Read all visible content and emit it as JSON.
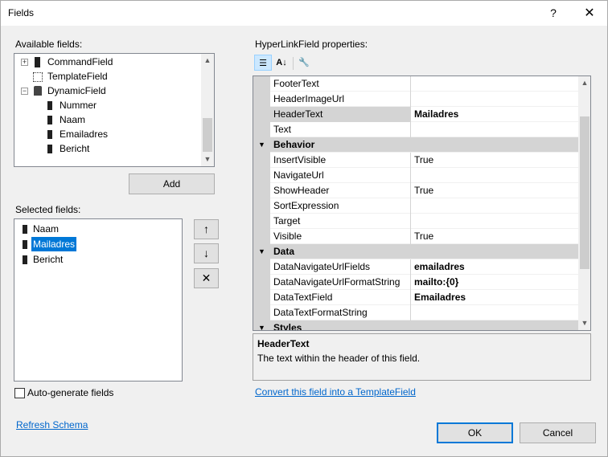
{
  "window": {
    "title": "Fields",
    "help_label": "?",
    "close_label": "✕"
  },
  "available": {
    "label": "Available fields:",
    "items": [
      {
        "label": "CommandField",
        "icon": "command-field-icon"
      },
      {
        "label": "TemplateField",
        "icon": "template-field-icon"
      },
      {
        "label": "DynamicField",
        "icon": "dynamic-field-icon"
      },
      {
        "label": "Nummer",
        "icon": "field-icon"
      },
      {
        "label": "Naam",
        "icon": "field-icon"
      },
      {
        "label": "Emailadres",
        "icon": "field-icon"
      },
      {
        "label": "Bericht",
        "icon": "field-icon"
      }
    ],
    "add_label": "Add"
  },
  "selected": {
    "label": "Selected fields:",
    "items": [
      {
        "label": "Naam"
      },
      {
        "label": "Mailadres",
        "selected": true
      },
      {
        "label": "Bericht"
      }
    ],
    "move_up": "↑",
    "move_down": "↓",
    "delete": "✕"
  },
  "auto_generate": {
    "label": "Auto-generate fields",
    "checked": false
  },
  "refresh_schema": "Refresh Schema",
  "properties": {
    "label": "HyperLinkField properties:",
    "toolbar": {
      "categorized": "categorized-icon",
      "alphabetical": "alphabetical-sort-icon",
      "property_pages": "wrench-icon"
    },
    "rows": [
      {
        "type": "prop",
        "name": "FooterText",
        "value": ""
      },
      {
        "type": "prop",
        "name": "HeaderImageUrl",
        "value": ""
      },
      {
        "type": "prop",
        "name": "HeaderText",
        "value": "Mailadres",
        "bold": true,
        "highlight": true
      },
      {
        "type": "prop",
        "name": "Text",
        "value": ""
      },
      {
        "type": "cat",
        "name": "Behavior"
      },
      {
        "type": "prop",
        "name": "InsertVisible",
        "value": "True"
      },
      {
        "type": "prop",
        "name": "NavigateUrl",
        "value": ""
      },
      {
        "type": "prop",
        "name": "ShowHeader",
        "value": "True"
      },
      {
        "type": "prop",
        "name": "SortExpression",
        "value": ""
      },
      {
        "type": "prop",
        "name": "Target",
        "value": ""
      },
      {
        "type": "prop",
        "name": "Visible",
        "value": "True"
      },
      {
        "type": "cat",
        "name": "Data"
      },
      {
        "type": "prop",
        "name": "DataNavigateUrlFields",
        "value": "emailadres",
        "bold": true
      },
      {
        "type": "prop",
        "name": "DataNavigateUrlFormatString",
        "value": "mailto:{0}",
        "bold": true
      },
      {
        "type": "prop",
        "name": "DataTextField",
        "value": "Emailadres",
        "bold": true
      },
      {
        "type": "prop",
        "name": "DataTextFormatString",
        "value": ""
      },
      {
        "type": "cat",
        "name": "Styles"
      }
    ],
    "description": {
      "title": "HeaderText",
      "text": "The text within the header of this field."
    }
  },
  "convert_link": "Convert this field into a TemplateField",
  "buttons": {
    "ok": "OK",
    "cancel": "Cancel"
  },
  "colors": {
    "accent": "#0078d7",
    "link": "#0066cc",
    "category_bg": "#d4d4d4"
  }
}
